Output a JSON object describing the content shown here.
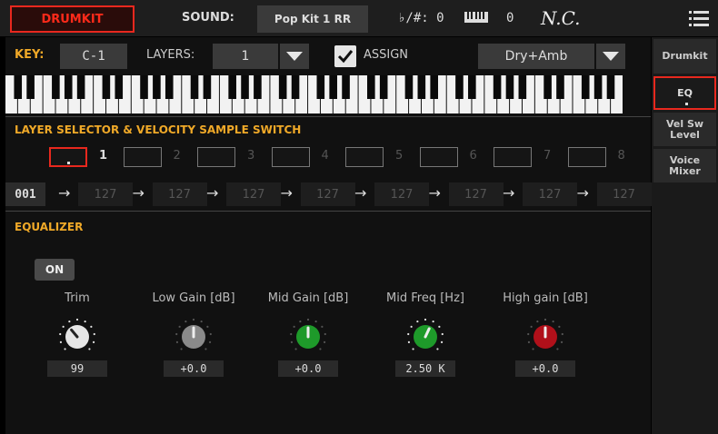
{
  "topbar": {
    "mode_button": "DRUMKIT",
    "sound_label": "SOUND:",
    "sound_name": "Pop Kit 1 RR",
    "transpose": "♭/#: 0",
    "keyboard_value": "0",
    "chord": "N.C.",
    "icons": {
      "keyboard": "keyboard-icon",
      "menu": "menu-icon"
    }
  },
  "key_row": {
    "key_label": "KEY:",
    "key_value": "C-1",
    "layers_label": "LAYERS:",
    "layers_value": "1",
    "assign_label": "ASSIGN",
    "assign_checked": true,
    "mix_value": "Dry+Amb"
  },
  "layer_section": {
    "title": "LAYER SELECTOR & VELOCITY SAMPLE SWITCH",
    "layers": [
      "1",
      "2",
      "3",
      "4",
      "5",
      "6",
      "7",
      "8"
    ],
    "selected_layer": "1",
    "velocity_start": "001",
    "velocity_values": [
      "127",
      "127",
      "127",
      "127",
      "127",
      "127",
      "127",
      "127"
    ]
  },
  "equalizer": {
    "title": "EQUALIZER",
    "on_label": "ON",
    "controls": [
      {
        "label": "Trim",
        "value": "99"
      },
      {
        "label": "Low Gain [dB]",
        "value": "+0.0"
      },
      {
        "label": "Mid Gain [dB]",
        "value": "+0.0"
      },
      {
        "label": "Mid Freq [Hz]",
        "value": "2.50 K"
      },
      {
        "label": "High gain [dB]",
        "value": "+0.0"
      }
    ]
  },
  "sidebar": {
    "tabs": [
      "Drumkit",
      "EQ",
      "Vel Sw\nLevel",
      "Voice\nMixer"
    ],
    "active": "EQ"
  },
  "colors": {
    "accent_red": "#e8281e",
    "section_orange": "#f0a928",
    "knob_green": "#1e9a2a",
    "knob_red": "#b0101a",
    "knob_grey": "#8a8a8a"
  }
}
